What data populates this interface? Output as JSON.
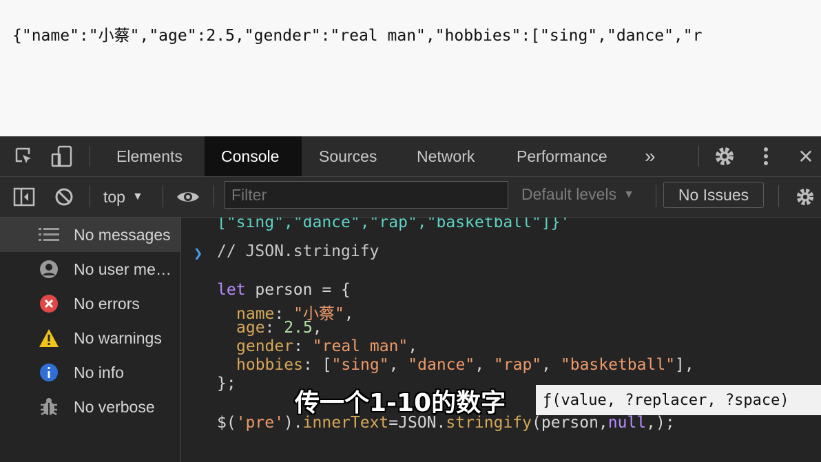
{
  "page": {
    "output_text": "{\"name\":\"小蔡\",\"age\":2.5,\"gender\":\"real man\",\"hobbies\":[\"sing\",\"dance\",\"r"
  },
  "devtools": {
    "tabs": [
      "Elements",
      "Console",
      "Sources",
      "Network",
      "Performance"
    ],
    "active_tab": "Console",
    "more_tabs": "»",
    "close": "✕",
    "toolbar": {
      "context": "top",
      "filter_placeholder": "Filter",
      "levels": "Default levels",
      "issues": "No Issues"
    },
    "sidebar": [
      {
        "label": "No messages",
        "icon": "list-icon"
      },
      {
        "label": "No user me…",
        "icon": "user-icon"
      },
      {
        "label": "No errors",
        "icon": "error-icon"
      },
      {
        "label": "No warnings",
        "icon": "warning-icon"
      },
      {
        "label": "No info",
        "icon": "info-icon"
      },
      {
        "label": "No verbose",
        "icon": "bug-icon"
      }
    ],
    "console": {
      "prev_output": "[\"sing\",\"dance\",\"rap\",\"basketball\"]}'",
      "comment": "// JSON.stringify",
      "code": {
        "let": "let",
        "decl": " person = {",
        "name_key": "name",
        "name_val": "\"小蔡\"",
        "age_key": "age",
        "age_val": "2.5",
        "gender_key": "gender",
        "gender_val": "\"real man\"",
        "hobbies_key": "hobbies",
        "hobbies": [
          "\"sing\"",
          "\"dance\"",
          "\"rap\"",
          "\"basketball\""
        ],
        "close": "};",
        "call_prefix": "$(",
        "call_sel": "'pre'",
        "call_mid": ").",
        "call_prop": "innerText",
        "call_eq": "=JSON.",
        "call_fn": "stringify",
        "call_args_a": "(person,",
        "call_null": "null",
        "call_args_b": ",);"
      },
      "signature_hint": "ƒ(value, ?replacer, ?space)"
    }
  },
  "subtitle": "传一个1-10的数字",
  "colors": {
    "prompt": "#4a9ff5",
    "error": "#e04848",
    "warning": "#f0c419",
    "info": "#2f6fd6"
  }
}
